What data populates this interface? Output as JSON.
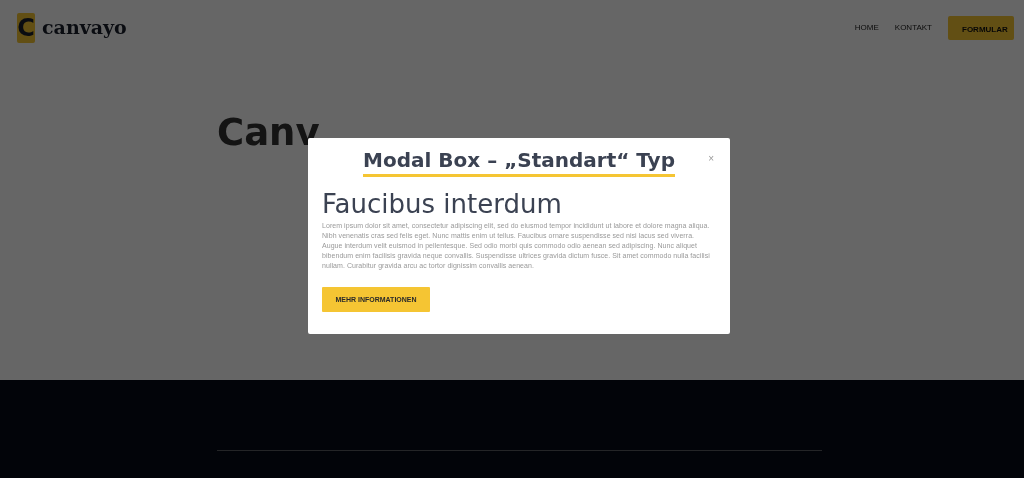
{
  "header": {
    "logo_letter": "C",
    "logo_text": "canvayo",
    "nav": [
      {
        "label": "HOME",
        "kind": "link"
      },
      {
        "label": "KONTAKT",
        "kind": "link"
      },
      {
        "label": "FORMULAR",
        "kind": "button"
      }
    ]
  },
  "hero": {
    "title": "Canv"
  },
  "modal": {
    "title": "Modal Box – „Standart“ Typ",
    "close": "×",
    "heading": "Faucibus interdum",
    "text": "Lorem ipsum dolor sit amet, consectetur adipiscing elit, sed do eiusmod tempor incididunt ut labore et dolore magna aliqua. Nibh venenatis cras sed felis eget. Nunc mattis enim ut tellus. Faucibus ornare suspendisse sed nisi lacus sed viverra. Augue interdum velit euismod in pellentesque. Sed odio morbi quis commodo odio aenean sed adipiscing. Nunc aliquet bibendum enim facilisis gravida neque convallis. Suspendisse ultrices gravida dictum fusce. Sit amet commodo nulla facilisi nullam. Curabitur gravida arcu ac tortor dignissim convallis aenean.",
    "button": "MEHR INFORMATIONEN"
  }
}
